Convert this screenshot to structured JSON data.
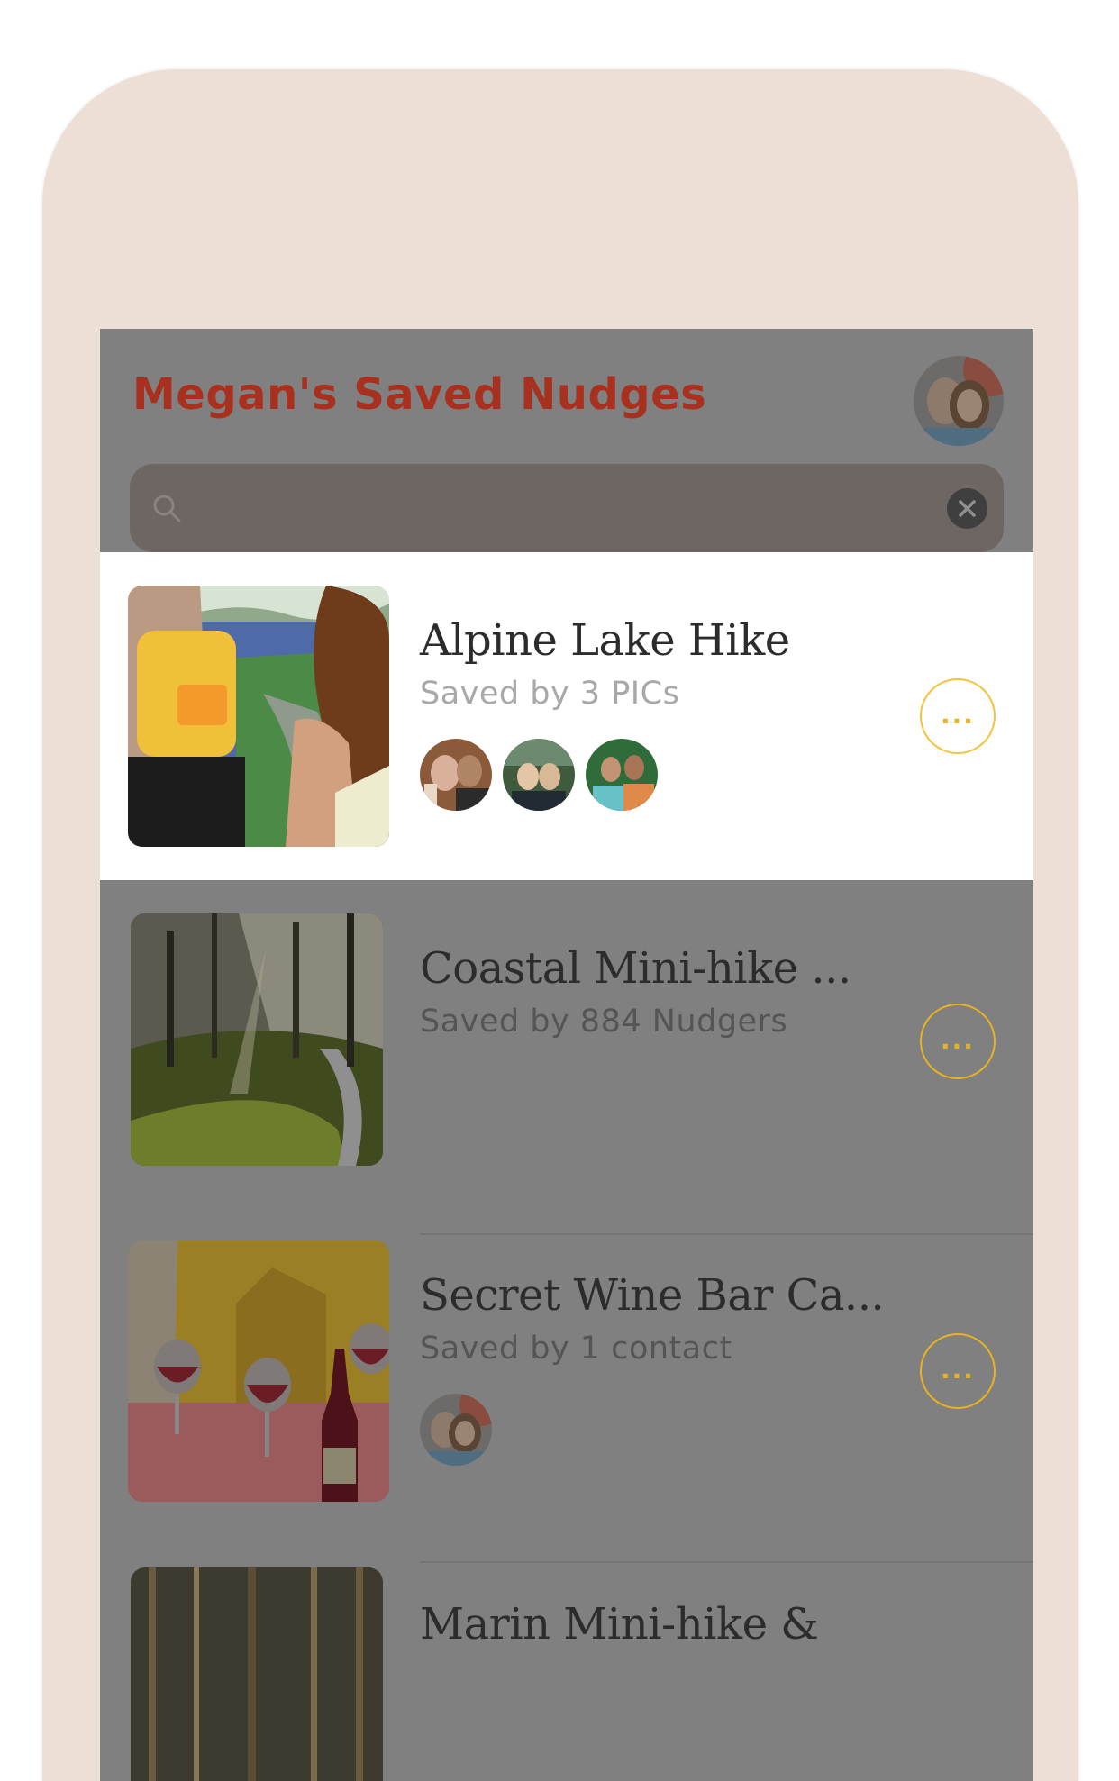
{
  "header": {
    "title": "Megan's Saved Nudges",
    "avatar_icon": "profile-avatar"
  },
  "search": {
    "placeholder": "",
    "value": "",
    "search_icon": "search-icon",
    "clear_icon": "close-icon"
  },
  "nudges": [
    {
      "title": "Alpine Lake Hike",
      "saved_by": "Saved by 3 PICs",
      "contacts": [
        "contact-avatar",
        "contact-avatar",
        "contact-avatar"
      ],
      "more_label": "...",
      "selected": true
    },
    {
      "title": "Coastal Mini-hike ...",
      "saved_by": "Saved by 884 Nudgers",
      "contacts": [],
      "more_label": "...",
      "selected": false
    },
    {
      "title": "Secret Wine Bar Ca...",
      "saved_by": "Saved by 1 contact",
      "contacts": [
        "contact-avatar"
      ],
      "more_label": "...",
      "selected": false
    },
    {
      "title": "Marin Mini-hike &",
      "saved_by": "",
      "contacts": [],
      "more_label": "...",
      "selected": false
    }
  ],
  "colors": {
    "title": "#a8301f",
    "accent": "#f5c23c",
    "overlay": "#808080",
    "phone_frame": "#eddfd5"
  }
}
